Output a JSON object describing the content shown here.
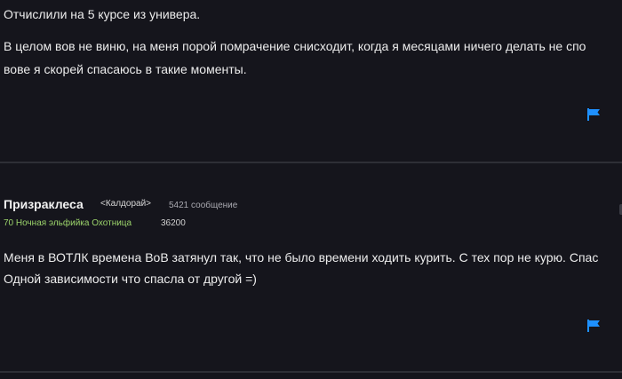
{
  "posts": [
    {
      "lines": [
        "Отчислили на 5 курсе из универа.",
        "В целом вов не виню, на меня порой помрачение снисходит, когда я месяцами ничего делать не спо",
        "вове я скорей спасаюсь в такие моменты."
      ],
      "flag_icon": "report-flag-icon"
    },
    {
      "author": {
        "name": "Призраклеса",
        "guild": "<Калдорай>",
        "message_count": "5421 сообщение",
        "character": "70 Ночная эльфийка Охотница",
        "achievement_points": "36200"
      },
      "lines": [
        "Меня в ВОТЛК времена ВоВ затянул так, что не было времени ходить курить. С тех пор не курю. Спас",
        "Одной зависимости что спасла от другой =)"
      ],
      "flag_icon": "report-flag-icon"
    }
  ],
  "colors": {
    "background": "#15151c",
    "divider": "#2e2f36",
    "text": "#ececec",
    "character_class": "#9bd36b",
    "flag": "#1e90ff"
  }
}
